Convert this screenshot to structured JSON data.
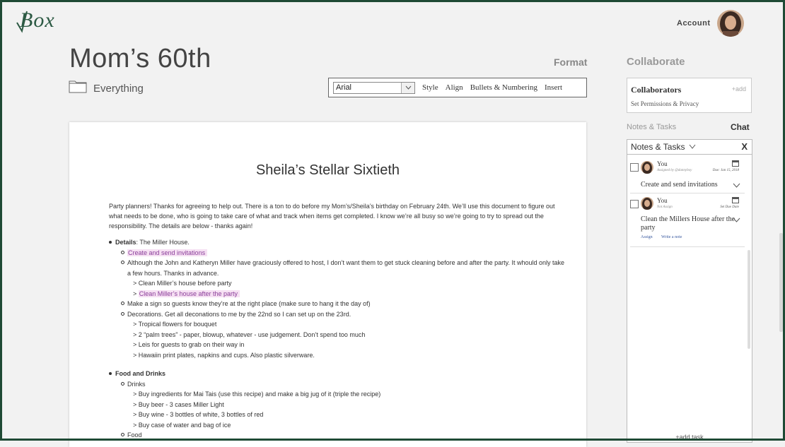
{
  "brand": {
    "name": "Box",
    "accent": "#2d5a44",
    "frame_color": "#1f4a35",
    "highlight_bg": "#f6e0f3",
    "highlight_text": "#8a3f9a"
  },
  "header": {
    "account_label": "Account"
  },
  "document": {
    "title": "Mom’s 60th",
    "folder": "Everything",
    "heading": "Sheila’s Stellar Sixtieth",
    "intro": "Party planners! Thanks for agreeing to help out. There is a ton to do before my Mom’s/Sheila’s birthday on February 24th. We’ll use this document to figure out what needs to be done, who is going to take care of what and track when items get completed. I know we’re all busy so we’re going to try to spread out the responsibility. The details are below - thanks again!",
    "details": {
      "label": "Details",
      "text": ": The Miller House.",
      "task1": "Create and send invitations",
      "offer": "Although the John and Katheryn Miller have graciously offered to host, I don’t want them to get stuck cleaning before and after the party. It whould only take a few hours. Thanks in advance.",
      "clean_before": "> Clean Miller’s house before party",
      "clean_after": "Clean Miller’s house after the party",
      "clean_after_prefix": ">",
      "sign": "Make a sign so guests know they’re at the right place (make sure to hang it the day of)",
      "decorations": "Decorations. Get all deconations to me by the 22nd so I can set up on the 23rd.",
      "deco_items": [
        "> Tropical flowers for bouquet",
        "> 2 “palm trees” - paper, blowup, whatever - use judgement. Don’t spend too much",
        "> Leis for guests to grab on their way in",
        "> Hawaiin print plates, napkins and cups. Also plastic silverware."
      ]
    },
    "food": {
      "label": "Food and Drinks",
      "drinks_label": "Drinks",
      "drink_items": [
        "> Buy ingredients for Mai Tais (use this recipe) and make a big jug of it (triple the recipe)",
        "> Buy beer - 3 cases Miller Light",
        "> Buy wine - 3 bottles of white, 3 bottles of red",
        "> Buy case of water and bag of ice"
      ],
      "food_label": "Food"
    }
  },
  "format": {
    "label": "Format",
    "font": "Arial",
    "tools": [
      "Style",
      "Align",
      "Bullets & Numbering",
      "Insert"
    ]
  },
  "collaborate": {
    "label": "Collaborate",
    "collaborators_title": "Collaborators",
    "add_label": "+add",
    "permissions": "Set Permissions & Privacy"
  },
  "sidepanel": {
    "tab_notes": "Notes & Tasks",
    "tab_chat": "Chat",
    "panel_title": "Notes & Tasks",
    "close": "X",
    "tasks": [
      {
        "user": "You",
        "sub": "Assigned by @dannyboy",
        "due": "Due: Jan 15, 2018",
        "text": "Create and send invitations"
      },
      {
        "user": "You",
        "sub": "Not Assign",
        "due": "Set Due Date",
        "text": "Clean the Millers House after the party",
        "link1": "Assign",
        "link2": "Write a note"
      }
    ],
    "add_task": "+add task"
  }
}
